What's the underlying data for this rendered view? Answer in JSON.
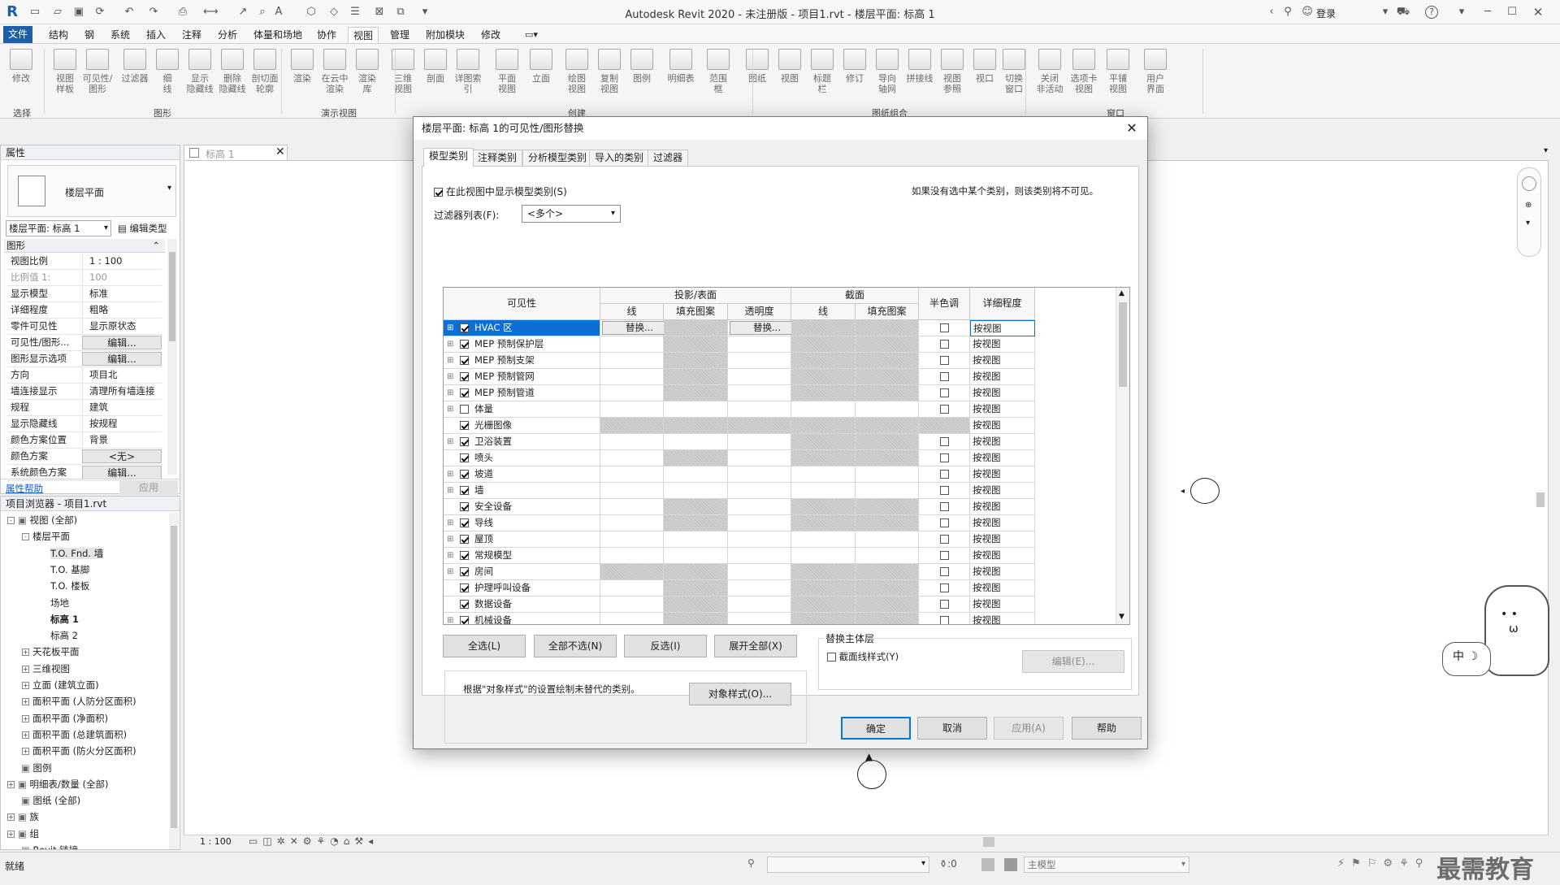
{
  "app": {
    "title": "Autodesk Revit 2020 - 未注册版 - 项目1.rvt - 楼层平面: 标高 1",
    "login": "登录",
    "help": "?"
  },
  "menu": [
    "文件",
    "结构",
    "钢",
    "系统",
    "插入",
    "注释",
    "分析",
    "体量和场地",
    "协作",
    "视图",
    "管理",
    "附加模块",
    "修改"
  ],
  "ribbon": {
    "buttons": [
      "修改",
      "视图\n样板",
      "可见性/\n图形",
      "过滤器",
      "细\n线",
      "显示\n隐藏线",
      "删除\n隐藏线",
      "剖切面\n轮廓",
      "渲染",
      "在云中\n渲染",
      "渲染\n库",
      "三维\n视图",
      "剖面",
      "详图索引",
      "平面\n视图",
      "立面",
      "绘图\n视图",
      "复制\n视图",
      "图例",
      "明细表",
      "范围\n框",
      "图纸",
      "视图",
      "标题\n栏",
      "修订",
      "导向\n轴网",
      "拼接线",
      "视图\n参照",
      "视口",
      "切换\n窗口",
      "关闭\n非活动",
      "选项卡\n视图",
      "平铺\n视图",
      "用户\n界面"
    ],
    "groups": [
      "选择",
      "图形",
      "演示视图",
      "创建",
      "图纸组合",
      "窗口"
    ]
  },
  "properties": {
    "header": "属性",
    "type_name": "楼层平面",
    "selector": "楼层平面: 标高 1",
    "edit_type": "编辑类型",
    "section": "图形",
    "rows": [
      {
        "k": "视图比例",
        "v": "1 : 100"
      },
      {
        "k": "比例值 1:",
        "v": "100"
      },
      {
        "k": "显示模型",
        "v": "标准"
      },
      {
        "k": "详细程度",
        "v": "粗略"
      },
      {
        "k": "零件可见性",
        "v": "显示原状态"
      },
      {
        "k": "可见性/图形...",
        "v": "编辑..."
      },
      {
        "k": "图形显示选项",
        "v": "编辑..."
      },
      {
        "k": "方向",
        "v": "项目北"
      },
      {
        "k": "墙连接显示",
        "v": "清理所有墙连接"
      },
      {
        "k": "规程",
        "v": "建筑"
      },
      {
        "k": "显示隐藏线",
        "v": "按规程"
      },
      {
        "k": "颜色方案位置",
        "v": "背景"
      },
      {
        "k": "颜色方案",
        "v": "<无>"
      },
      {
        "k": "系统颜色方案",
        "v": "编辑..."
      }
    ],
    "help_link": "属性帮助",
    "apply": "应用"
  },
  "browser": {
    "header": "项目浏览器 - 项目1.rvt",
    "items": [
      {
        "t": "视图 (全部)",
        "lvl": 0,
        "exp": "-"
      },
      {
        "t": "楼层平面",
        "lvl": 1,
        "exp": "-"
      },
      {
        "t": "T.O. Fnd. 墙",
        "lvl": 2,
        "exp": ""
      },
      {
        "t": "T.O. 基脚",
        "lvl": 2,
        "exp": ""
      },
      {
        "t": "T.O. 楼板",
        "lvl": 2,
        "exp": ""
      },
      {
        "t": "场地",
        "lvl": 2,
        "exp": ""
      },
      {
        "t": "标高 1",
        "lvl": 2,
        "exp": ""
      },
      {
        "t": "标高 2",
        "lvl": 2,
        "exp": ""
      },
      {
        "t": "天花板平面",
        "lvl": 1,
        "exp": "+"
      },
      {
        "t": "三维视图",
        "lvl": 1,
        "exp": "+"
      },
      {
        "t": "立面 (建筑立面)",
        "lvl": 1,
        "exp": "+"
      },
      {
        "t": "面积平面 (人防分区面积)",
        "lvl": 1,
        "exp": "+"
      },
      {
        "t": "面积平面 (净面积)",
        "lvl": 1,
        "exp": "+"
      },
      {
        "t": "面积平面 (总建筑面积)",
        "lvl": 1,
        "exp": "+"
      },
      {
        "t": "面积平面 (防火分区面积)",
        "lvl": 1,
        "exp": "+"
      },
      {
        "t": "图例",
        "lvl": 0,
        "exp": ""
      },
      {
        "t": "明细表/数量 (全部)",
        "lvl": 0,
        "exp": "+"
      },
      {
        "t": "图纸 (全部)",
        "lvl": 0,
        "exp": ""
      },
      {
        "t": "族",
        "lvl": 0,
        "exp": "+"
      },
      {
        "t": "组",
        "lvl": 0,
        "exp": "+"
      },
      {
        "t": "Revit 链接",
        "lvl": 0,
        "exp": ""
      }
    ]
  },
  "view_tab": "标高 1",
  "view_scale": "1 : 100",
  "status": {
    "ready": "就绪",
    "coord": ":0",
    "model": "主模型"
  },
  "watermark": "最需教育",
  "dialog": {
    "title": "楼层平面: 标高 1的可见性/图形替换",
    "tabs": [
      "模型类别",
      "注释类别",
      "分析模型类别",
      "导入的类别",
      "过滤器"
    ],
    "show_label": "在此视图中显示模型类别(S)",
    "info": "如果没有选中某个类别，则该类别将不可见。",
    "filter_label": "过滤器列表(F):",
    "filter_value": "<多个>",
    "headers": {
      "visibility": "可见性",
      "proj": "投影/表面",
      "cut": "截面",
      "halftone": "半色调",
      "detail": "详细程度",
      "line": "线",
      "fill": "填充图案",
      "trans": "透明度",
      "cline": "线",
      "cfill": "填充图案"
    },
    "rows": [
      {
        "name": "HVAC 区",
        "exp": "+",
        "on": true,
        "g": [
          0,
          1,
          0,
          1,
          1
        ],
        "half": true,
        "detail": "按视图",
        "sel": true,
        "line_btn": "替换...",
        "trans_btn": "替换..."
      },
      {
        "name": "MEP 预制保护层",
        "exp": "+",
        "on": true,
        "g": [
          0,
          1,
          0,
          1,
          1
        ],
        "half": true,
        "detail": "按视图"
      },
      {
        "name": "MEP 预制支架",
        "exp": "+",
        "on": true,
        "g": [
          0,
          1,
          0,
          1,
          1
        ],
        "half": true,
        "detail": "按视图"
      },
      {
        "name": "MEP 预制管网",
        "exp": "+",
        "on": true,
        "g": [
          0,
          1,
          0,
          1,
          1
        ],
        "half": true,
        "detail": "按视图"
      },
      {
        "name": "MEP 预制管道",
        "exp": "+",
        "on": true,
        "g": [
          0,
          1,
          0,
          1,
          1
        ],
        "half": true,
        "detail": "按视图"
      },
      {
        "name": "体量",
        "exp": "+",
        "on": false,
        "g": [
          0,
          0,
          0,
          0,
          0
        ],
        "half": true,
        "detail": "按视图"
      },
      {
        "name": "光栅图像",
        "exp": "",
        "on": true,
        "g": [
          1,
          1,
          1,
          1,
          1
        ],
        "half": false,
        "detail": "按视图"
      },
      {
        "name": "卫浴装置",
        "exp": "+",
        "on": true,
        "g": [
          0,
          0,
          0,
          1,
          1
        ],
        "half": true,
        "detail": "按视图"
      },
      {
        "name": "喷头",
        "exp": "",
        "on": true,
        "g": [
          0,
          1,
          0,
          1,
          1
        ],
        "half": true,
        "detail": "按视图"
      },
      {
        "name": "坡道",
        "exp": "+",
        "on": true,
        "g": [
          0,
          0,
          0,
          0,
          0
        ],
        "half": true,
        "detail": "按视图"
      },
      {
        "name": "墙",
        "exp": "+",
        "on": true,
        "g": [
          0,
          0,
          0,
          0,
          0
        ],
        "half": true,
        "detail": "按视图"
      },
      {
        "name": "安全设备",
        "exp": "",
        "on": true,
        "g": [
          0,
          1,
          0,
          1,
          1
        ],
        "half": true,
        "detail": "按视图"
      },
      {
        "name": "导线",
        "exp": "+",
        "on": true,
        "g": [
          0,
          1,
          0,
          1,
          1
        ],
        "half": true,
        "detail": "按视图"
      },
      {
        "name": "屋顶",
        "exp": "+",
        "on": true,
        "g": [
          0,
          0,
          0,
          0,
          0
        ],
        "half": true,
        "detail": "按视图"
      },
      {
        "name": "常规模型",
        "exp": "+",
        "on": true,
        "g": [
          0,
          0,
          0,
          0,
          0
        ],
        "half": true,
        "detail": "按视图"
      },
      {
        "name": "房间",
        "exp": "+",
        "on": true,
        "g": [
          1,
          1,
          0,
          1,
          1
        ],
        "half": true,
        "detail": "按视图"
      },
      {
        "name": "护理呼叫设备",
        "exp": "",
        "on": true,
        "g": [
          0,
          1,
          0,
          1,
          1
        ],
        "half": true,
        "detail": "按视图"
      },
      {
        "name": "数据设备",
        "exp": "",
        "on": true,
        "g": [
          0,
          1,
          0,
          1,
          1
        ],
        "half": true,
        "detail": "按视图"
      },
      {
        "name": "机械设备",
        "exp": "+",
        "on": true,
        "g": [
          0,
          1,
          0,
          1,
          1
        ],
        "half": true,
        "detail": "按视图"
      }
    ],
    "btn_all": "全选(L)",
    "btn_none": "全部不选(N)",
    "btn_invert": "反选(I)",
    "btn_expand": "展开全部(X)",
    "host_title": "替换主体层",
    "host_check": "截面线样式(Y)",
    "host_edit": "编辑(E)...",
    "note": "根据\"对象样式\"的设置绘制未替代的类别。",
    "obj_styles": "对象样式(O)...",
    "ok": "确定",
    "cancel": "取消",
    "apply": "应用(A)",
    "help": "帮助"
  }
}
